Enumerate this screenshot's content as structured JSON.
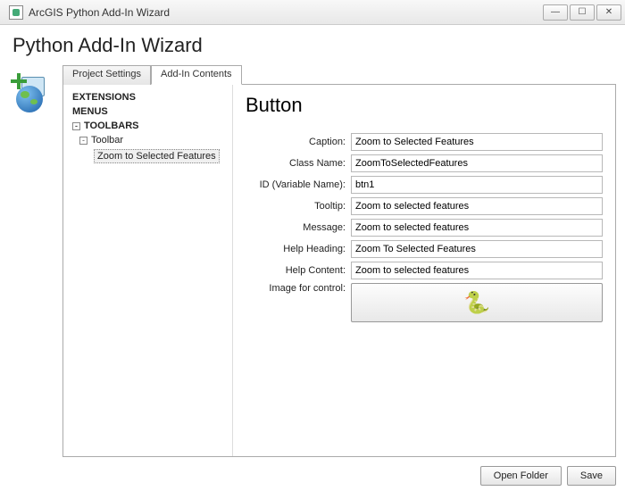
{
  "window": {
    "title": "ArcGIS Python Add-In Wizard",
    "heading": "Python Add-In Wizard"
  },
  "tabs": {
    "project_settings": "Project Settings",
    "addin_contents": "Add-In Contents"
  },
  "tree": {
    "extensions": "EXTENSIONS",
    "menus": "MENUS",
    "toolbars": "TOOLBARS",
    "toolbar": "Toolbar",
    "selected": "Zoom to Selected Features"
  },
  "form": {
    "title": "Button",
    "labels": {
      "caption": "Caption:",
      "class_name": "Class Name:",
      "id": "ID (Variable Name):",
      "tooltip": "Tooltip:",
      "message": "Message:",
      "help_heading": "Help Heading:",
      "help_content": "Help Content:",
      "image": "Image for control:"
    },
    "values": {
      "caption": "Zoom to Selected Features",
      "class_name": "ZoomToSelectedFeatures",
      "id": "btn1",
      "tooltip": "Zoom to selected features",
      "message": "Zoom to selected features",
      "help_heading": "Zoom To Selected Features",
      "help_content": "Zoom to selected features"
    }
  },
  "footer": {
    "open_folder": "Open Folder",
    "save": "Save"
  }
}
